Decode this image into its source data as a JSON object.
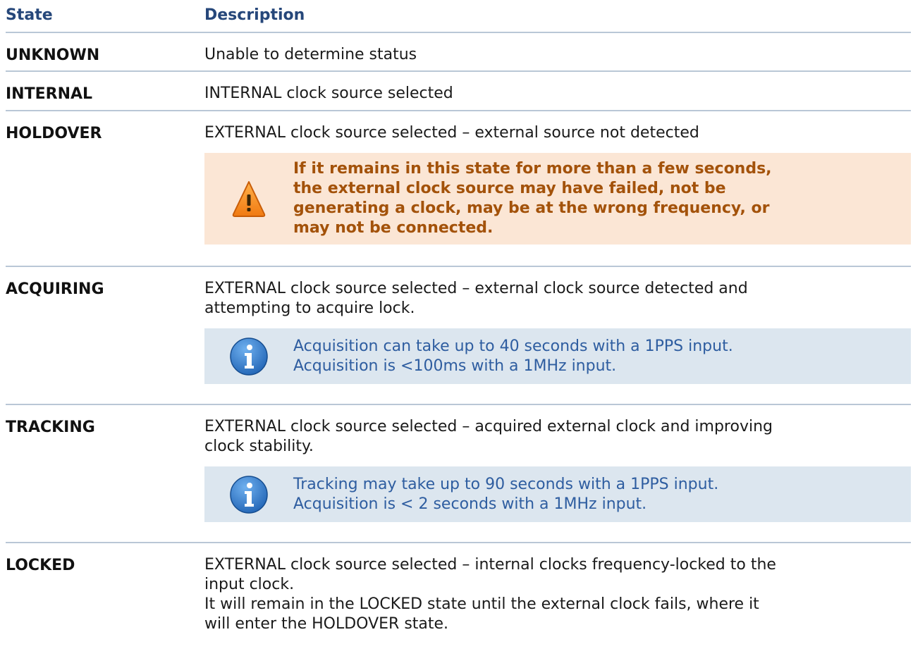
{
  "header": {
    "state": "State",
    "description": "Description"
  },
  "rows": [
    {
      "state": "UNKNOWN",
      "description": [
        "Unable to determine status"
      ]
    },
    {
      "state": "INTERNAL",
      "description": [
        "INTERNAL clock source selected"
      ]
    },
    {
      "state": "HOLDOVER",
      "description": [
        "EXTERNAL clock source selected – external source not detected"
      ],
      "callout": {
        "type": "warning",
        "icon": "warning-triangle-icon",
        "lines": [
          "If it remains in this state for more than a few seconds,",
          "the external clock source may have failed, not be",
          "generating a clock, may be at the wrong frequency, or",
          "may not be connected."
        ]
      }
    },
    {
      "state": "ACQUIRING",
      "description": [
        "EXTERNAL clock source selected – external clock source detected and",
        "attempting to acquire lock."
      ],
      "callout": {
        "type": "info",
        "icon": "info-icon",
        "lines": [
          "Acquisition can take up to 40 seconds with a 1PPS input.",
          "Acquisition is <100ms with a 1MHz input."
        ]
      }
    },
    {
      "state": "TRACKING",
      "description": [
        "EXTERNAL clock source selected – acquired external clock and improving",
        "clock stability."
      ],
      "callout": {
        "type": "info",
        "icon": "info-icon",
        "lines": [
          "Tracking may take up to 90 seconds with a 1PPS input.",
          "Acquisition is < 2 seconds with a 1MHz input."
        ]
      }
    },
    {
      "state": "LOCKED",
      "description": [
        "EXTERNAL clock source selected – internal clocks frequency-locked to the",
        "input clock.",
        "It will remain in the LOCKED state until the external clock fails, where it",
        "will enter the HOLDOVER state."
      ]
    }
  ],
  "colors": {
    "header_text": "#26477a",
    "rule": "#b9c7d6",
    "warning_bg": "#fbe6d5",
    "warning_text": "#a3520a",
    "info_bg": "#dce6ef",
    "info_text": "#2e5da0"
  }
}
